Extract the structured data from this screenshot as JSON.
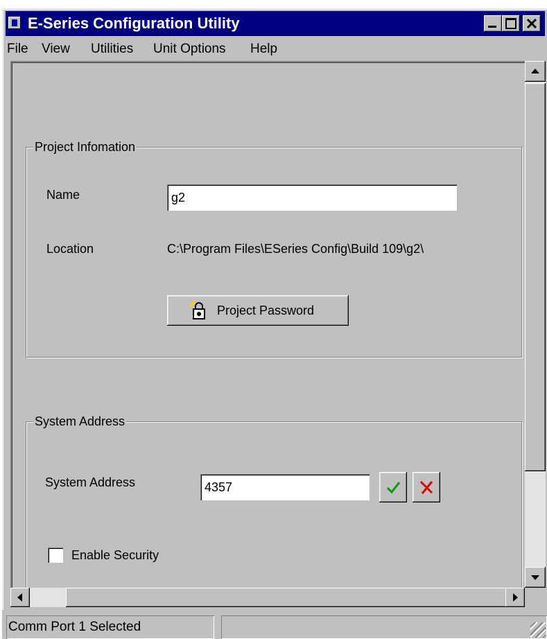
{
  "window": {
    "title": "E-Series Configuration Utility",
    "controls": [
      "minimize",
      "maximize",
      "close"
    ]
  },
  "menu": {
    "items": [
      {
        "label": "File"
      },
      {
        "label": "View"
      },
      {
        "label": "Utilities"
      },
      {
        "label": "Unit Options"
      },
      {
        "label": "Help"
      }
    ]
  },
  "project": {
    "group_label": "Project Infomation",
    "name_label": "Name",
    "name_value": "g2",
    "location_label": "Location",
    "location_value": "C:\\Program Files\\ESeries Config\\Build 109\\g2\\",
    "password_button": "Project Password"
  },
  "system": {
    "group_label": "System Address",
    "address_label": "System Address",
    "address_value": "4357",
    "enable_security_label": "Enable Security",
    "enable_security_checked": false
  },
  "status": {
    "text": "Comm Port 1 Selected"
  },
  "icons": {
    "app": "app-icon",
    "password": "lock-key-icon",
    "confirm": "checkmark-icon",
    "cancel": "red-x-icon"
  },
  "colors": {
    "titlebar": "#000080",
    "face": "#c0c0c0",
    "confirm": "#00a000",
    "cancel": "#e00000"
  }
}
